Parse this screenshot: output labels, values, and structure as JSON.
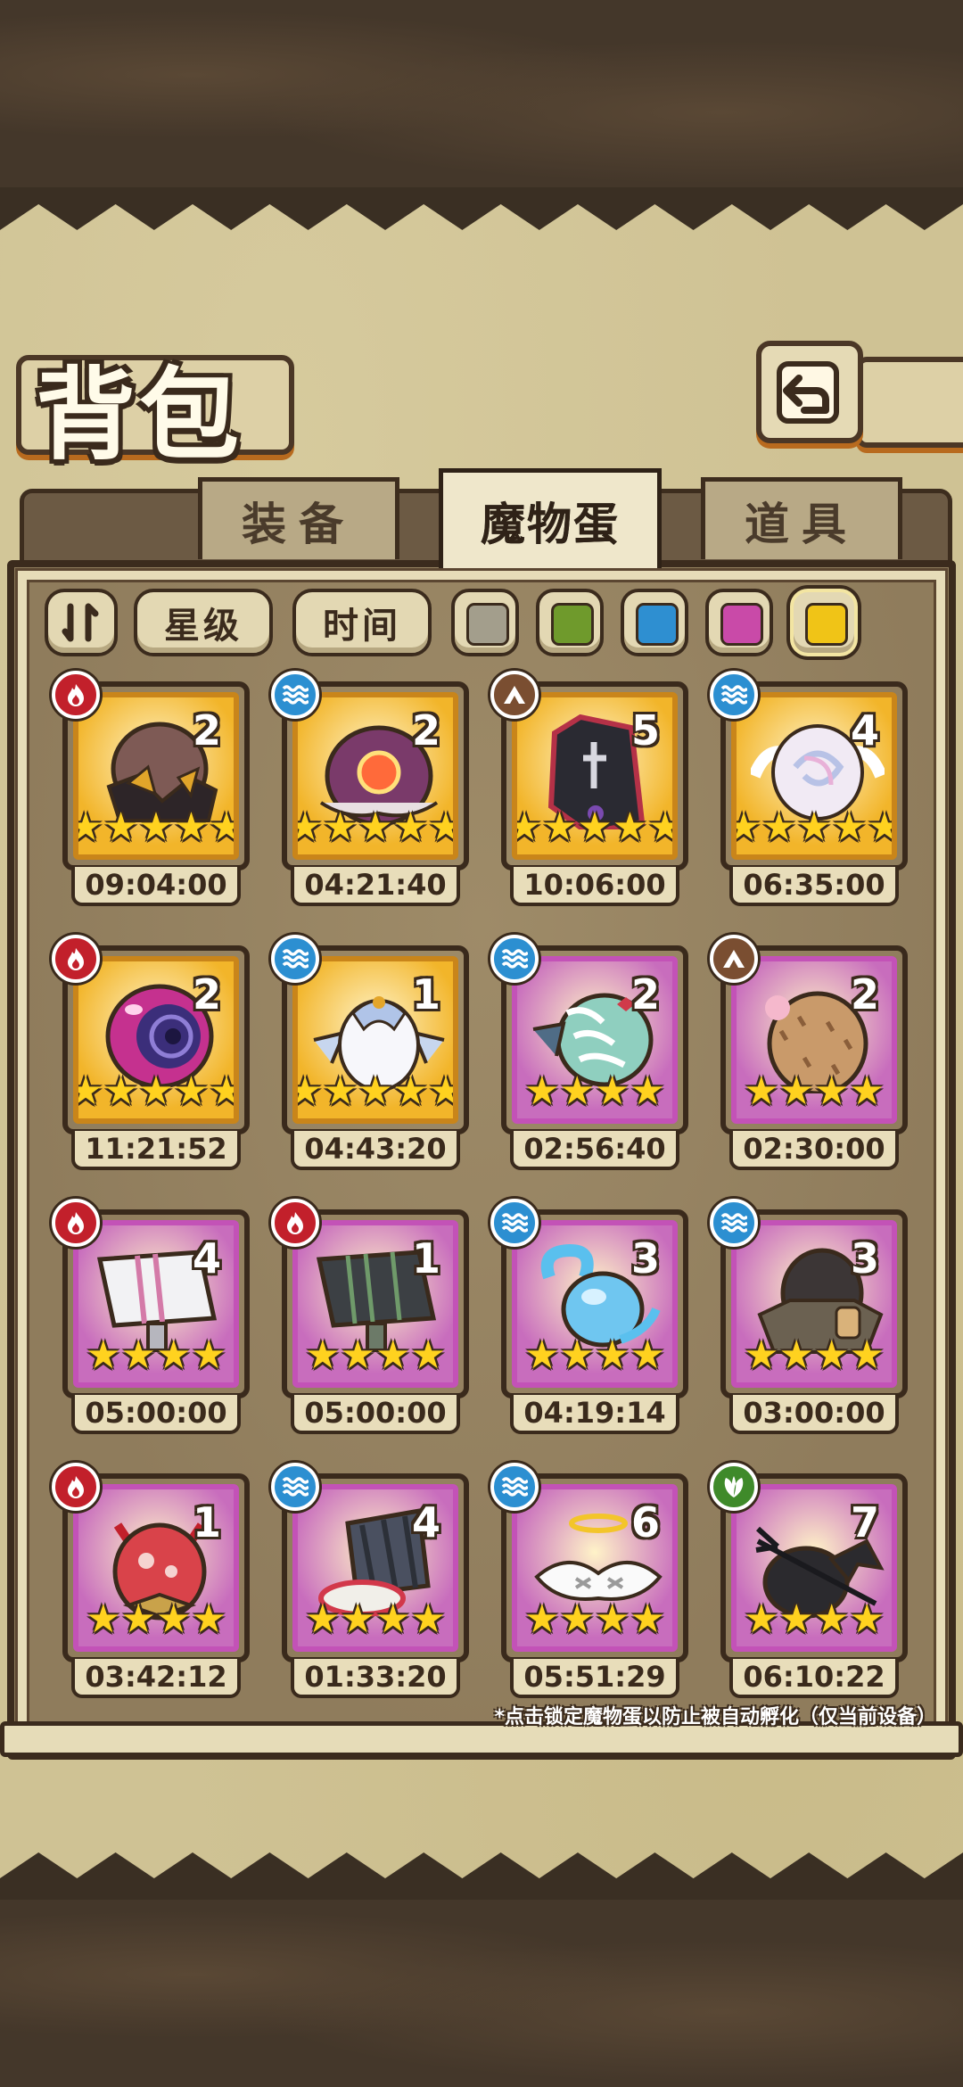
{
  "title": "背包",
  "tabs": [
    {
      "label": "装备",
      "active": false
    },
    {
      "label": "魔物蛋",
      "active": true
    },
    {
      "label": "道具",
      "active": false
    }
  ],
  "filters": {
    "sort_icon": "sort-toggle-icon",
    "star_label": "星级",
    "time_label": "时间",
    "colors": [
      {
        "name": "gray",
        "hex": "#a39e8c"
      },
      {
        "name": "green",
        "hex": "#6f9a2c"
      },
      {
        "name": "blue",
        "hex": "#2e8fd1"
      },
      {
        "name": "pink",
        "hex": "#c94aa8"
      },
      {
        "name": "yellow",
        "hex": "#f0c417",
        "selected": true
      }
    ]
  },
  "eggs": [
    {
      "element": "fire",
      "count": "2",
      "stars": 5,
      "rarity": "gold",
      "timer": "09:04:00",
      "art": "rock-horn-egg"
    },
    {
      "element": "water",
      "count": "2",
      "stars": 5,
      "rarity": "gold",
      "timer": "04:21:40",
      "art": "crab-eye-egg"
    },
    {
      "element": "earth",
      "count": "5",
      "stars": 5,
      "rarity": "gold",
      "timer": "10:06:00",
      "art": "coffin-egg"
    },
    {
      "element": "water",
      "count": "4",
      "stars": 5,
      "rarity": "gold",
      "timer": "06:35:00",
      "art": "pearl-wing-egg"
    },
    {
      "element": "fire",
      "count": "2",
      "stars": 5,
      "rarity": "gold",
      "timer": "11:21:52",
      "art": "vortex-orb-egg"
    },
    {
      "element": "water",
      "count": "1",
      "stars": 5,
      "rarity": "gold",
      "timer": "04:43:20",
      "art": "fin-crown-egg"
    },
    {
      "element": "water",
      "count": "2",
      "stars": 4,
      "rarity": "pink",
      "timer": "02:56:40",
      "art": "skeleton-egg"
    },
    {
      "element": "earth",
      "count": "2",
      "stars": 4,
      "rarity": "pink",
      "timer": "02:30:00",
      "art": "furry-egg"
    },
    {
      "element": "fire",
      "count": "4",
      "stars": 4,
      "rarity": "pink",
      "timer": "05:00:00",
      "art": "pink-hammer-egg"
    },
    {
      "element": "fire",
      "count": "1",
      "stars": 4,
      "rarity": "pink",
      "timer": "05:00:00",
      "art": "green-hammer-egg"
    },
    {
      "element": "water",
      "count": "3",
      "stars": 4,
      "rarity": "pink",
      "timer": "04:19:14",
      "art": "slime-egg"
    },
    {
      "element": "water",
      "count": "3",
      "stars": 4,
      "rarity": "pink",
      "timer": "03:00:00",
      "art": "crate-egg"
    },
    {
      "element": "fire",
      "count": "1",
      "stars": 4,
      "rarity": "pink",
      "timer": "03:42:12",
      "art": "devil-bow-egg"
    },
    {
      "element": "water",
      "count": "4",
      "stars": 4,
      "rarity": "pink",
      "timer": "01:33:20",
      "art": "drill-shell-egg"
    },
    {
      "element": "water",
      "count": "6",
      "stars": 4,
      "rarity": "pink",
      "timer": "05:51:29",
      "art": "angel-egg"
    },
    {
      "element": "nature",
      "count": "7",
      "stars": 4,
      "rarity": "pink",
      "timer": "06:10:22",
      "art": "bat-trident-egg"
    }
  ],
  "hint": "*点击锁定魔物蛋以防止被自动孵化（仅当前设备）",
  "colors": {
    "fire": "#c2202b",
    "water": "#2c8fd1",
    "earth": "#7a4e31",
    "nature": "#3f8a2a",
    "gold_bg": "#f2b52a",
    "pink_bg": "#c86dbd"
  }
}
